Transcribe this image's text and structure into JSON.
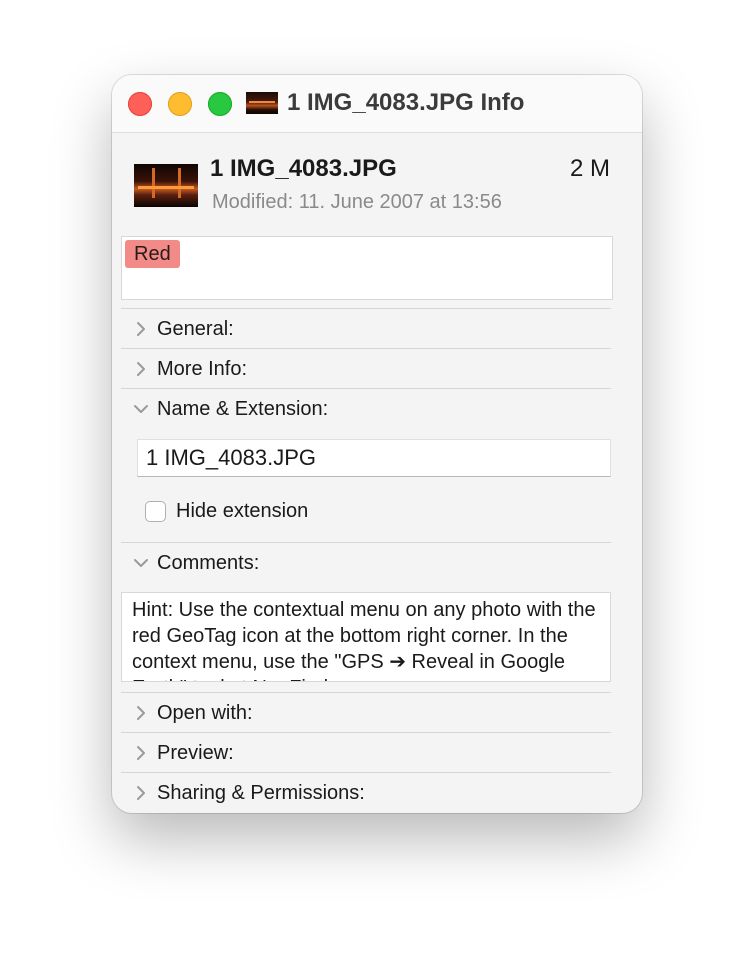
{
  "window": {
    "title": "1 IMG_4083.JPG Info"
  },
  "header": {
    "file_name": "1 IMG_4083.JPG",
    "size": "2 M",
    "modified": "Modified: 11. June 2007 at 13:56"
  },
  "tags": [
    "Red"
  ],
  "colors": {
    "tag_red": "#f28a88",
    "close": "#fe5f57",
    "minimize": "#febc2e",
    "zoom": "#28c840"
  },
  "sections": {
    "general": {
      "label": "General:",
      "expanded": false
    },
    "more_info": {
      "label": "More Info:",
      "expanded": false
    },
    "name_extension": {
      "label": "Name & Extension:",
      "expanded": true,
      "name_value": "1 IMG_4083.JPG",
      "hide_extension_label": "Hide extension",
      "hide_extension_checked": false
    },
    "comments": {
      "label": "Comments:",
      "expanded": true,
      "text": "Hint: Use the contextual menu on any photo with the red GeoTag icon at the bottom right corner. In the context menu, use the \"GPS ➔ Reveal in Google Earth\" tool at NeoFinder"
    },
    "open_with": {
      "label": "Open with:",
      "expanded": false
    },
    "preview": {
      "label": "Preview:",
      "expanded": false
    },
    "sharing": {
      "label": "Sharing & Permissions:",
      "expanded": false
    }
  },
  "icons": {
    "collapsed": "chevron-right-icon",
    "expanded": "chevron-down-icon"
  }
}
